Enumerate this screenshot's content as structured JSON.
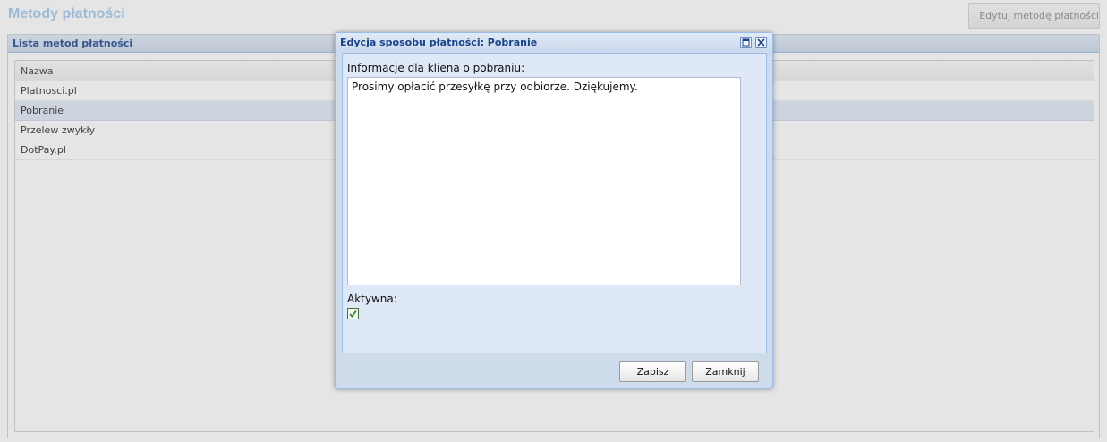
{
  "page": {
    "title": "Metody płatności",
    "edit_button_label": "Edytuj metodę płatności",
    "edit_button_icon": "pencil-icon"
  },
  "panel": {
    "title": "Lista metod płatności",
    "grid": {
      "column_header": "Nazwa",
      "rows": [
        "Platnosci.pl",
        "Pobranie",
        "Przelew zwykły",
        "DotPay.pl"
      ],
      "selected_index": 1
    }
  },
  "dialog": {
    "title": "Edycja sposobu płatności: Pobranie",
    "info_label": "Informacje dla kliena o pobraniu:",
    "info_value": "Prosimy opłacić przesyłkę przy odbiorze. Dziękujemy.",
    "active_label": "Aktywna:",
    "active_checked": true,
    "save_label": "Zapisz",
    "close_label": "Zamknij",
    "maximize_icon": "maximize-icon",
    "close_icon": "close-icon"
  },
  "colors": {
    "accent": "#15428b",
    "page_title": "#9fc6ea",
    "selected_row": "#dfe8f6",
    "dialog_bg": "#cedbeb"
  }
}
